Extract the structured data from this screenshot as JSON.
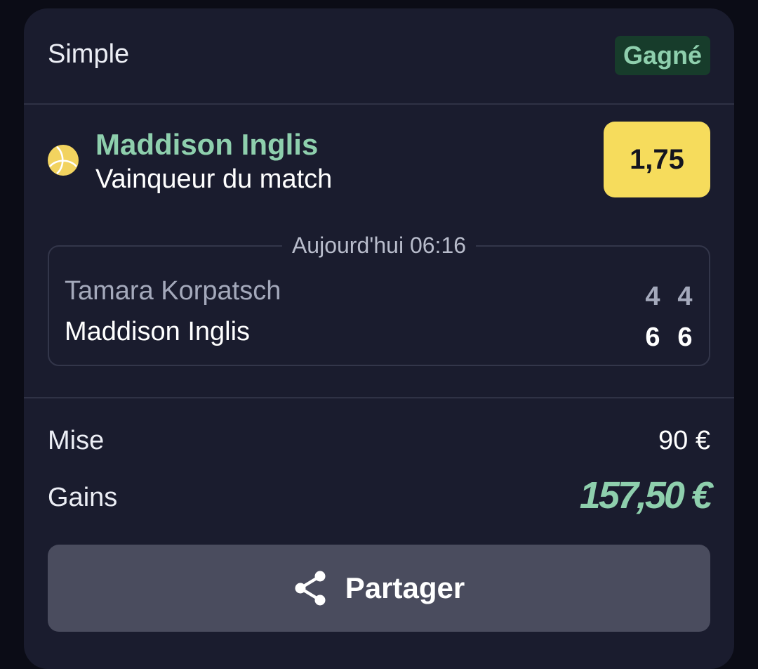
{
  "bet": {
    "type": "Simple",
    "status": "Gagné"
  },
  "selection": {
    "sport_icon": "tennis-ball-icon",
    "name": "Maddison Inglis",
    "market": "Vainqueur du match",
    "odds": "1,75"
  },
  "match": {
    "datetime": "Aujourd'hui 06:16",
    "teams": [
      {
        "name": "Tamara Korpatsch",
        "sets": [
          "4",
          "4"
        ]
      },
      {
        "name": "Maddison Inglis",
        "sets": [
          "6",
          "6"
        ]
      }
    ]
  },
  "summary": {
    "stake_label": "Mise",
    "stake_value": "90 €",
    "winnings_label": "Gains",
    "winnings_value": "157,50 €"
  },
  "actions": {
    "share_label": "Partager",
    "share_icon": "share-icon"
  },
  "colors": {
    "background": "#1a1c2e",
    "accent_green": "#8ecfad",
    "status_badge_bg": "#173c2b",
    "odds_yellow": "#f6dc5c",
    "share_button_bg": "#4a4c5e"
  }
}
